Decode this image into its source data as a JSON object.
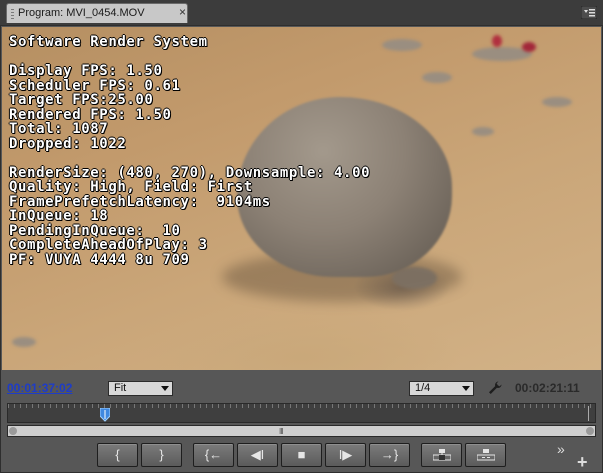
{
  "tab": {
    "title": "Program: MVI_0454.MOV",
    "close_glyph": "×"
  },
  "overlay": {
    "lines": [
      "Software Render System",
      "",
      "Display FPS: 1.50",
      "Scheduler FPS: 0.61",
      "Target FPS:25.00",
      "Rendered FPS: 1.50",
      "Total: 1087",
      "Dropped: 1022",
      "",
      "RenderSize: (480, 270), Downsample: 4.00",
      "Quality: High, Field: First",
      "FramePrefetchLatency:  9104ms",
      "InQueue: 18",
      "PendingInQueue:  10",
      "CompleteAheadOfPlay: 3",
      "PF: VUYA 4444 8u 709"
    ]
  },
  "controls": {
    "current_timecode": "00:01:37:02",
    "zoom_select": "Fit",
    "resolution_select": "1/4",
    "duration_timecode": "00:02:21:11",
    "zoom_grip": "III",
    "more_glyph": "»",
    "add_glyph": "+"
  },
  "playhead": {
    "position_fraction": 0.165
  },
  "transport": {
    "mark_in": "{",
    "mark_out": "}",
    "goto_in": "{←",
    "step_back": "◀I",
    "stop": "■",
    "step_forward": "I▶",
    "goto_out": "→}"
  },
  "colors": {
    "timecode_link": "#1e3cc8",
    "panel_bg": "#575757"
  }
}
